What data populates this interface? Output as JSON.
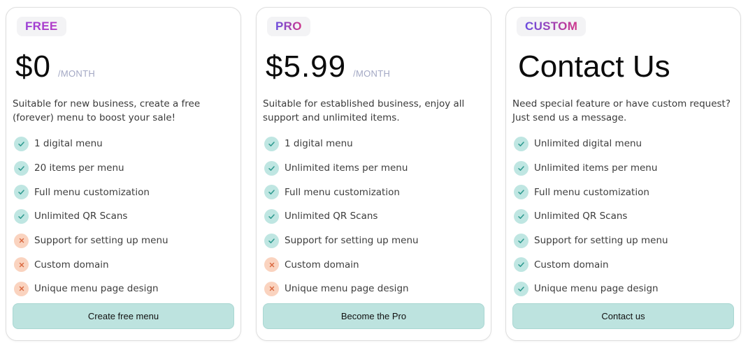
{
  "plans": [
    {
      "badge": "FREE",
      "price": "$0",
      "per": "/MONTH",
      "description": "Suitable for new business, create a free (forever) menu to boost your sale!",
      "features": [
        {
          "label": "1 digital menu",
          "icon": "check-icon",
          "included": true
        },
        {
          "label": "20 items per menu",
          "icon": "check-icon",
          "included": true
        },
        {
          "label": "Full menu customization",
          "icon": "check-icon",
          "included": true
        },
        {
          "label": "Unlimited QR Scans",
          "icon": "check-icon",
          "included": true
        },
        {
          "label": "Support for setting up menu",
          "icon": "cross-icon",
          "included": false
        },
        {
          "label": "Custom domain",
          "icon": "cross-icon",
          "included": false
        },
        {
          "label": "Unique menu page design",
          "icon": "cross-icon",
          "included": false
        }
      ],
      "cta": "Create free menu"
    },
    {
      "badge": "PRO",
      "price": "$5.99",
      "per": "/MONTH",
      "description": "Suitable for established business, enjoy all support and unlimited items.",
      "features": [
        {
          "label": "1 digital menu",
          "icon": "check-icon",
          "included": true
        },
        {
          "label": "Unlimited items per menu",
          "icon": "check-icon",
          "included": true
        },
        {
          "label": "Full menu customization",
          "icon": "check-icon",
          "included": true
        },
        {
          "label": "Unlimited QR Scans",
          "icon": "check-icon",
          "included": true
        },
        {
          "label": "Support for setting up menu",
          "icon": "check-icon",
          "included": true
        },
        {
          "label": "Custom domain",
          "icon": "cross-icon",
          "included": false
        },
        {
          "label": "Unique menu page design",
          "icon": "cross-icon",
          "included": false
        }
      ],
      "cta": "Become the Pro"
    },
    {
      "badge": "CUSTOM",
      "price": "Contact Us",
      "per": "",
      "description": "Need special feature or have custom request? Just send us a message.",
      "features": [
        {
          "label": "Unlimited digital menu",
          "icon": "check-icon",
          "included": true
        },
        {
          "label": "Unlimited items per menu",
          "icon": "check-icon",
          "included": true
        },
        {
          "label": "Full menu customization",
          "icon": "check-icon",
          "included": true
        },
        {
          "label": "Unlimited QR Scans",
          "icon": "check-icon",
          "included": true
        },
        {
          "label": "Support for setting up menu",
          "icon": "check-icon",
          "included": true
        },
        {
          "label": "Custom domain",
          "icon": "check-icon",
          "included": true
        },
        {
          "label": "Unique menu page design",
          "icon": "check-icon",
          "included": true
        }
      ],
      "cta": "Contact us"
    }
  ],
  "colors": {
    "check_bg": "#bfe6e2",
    "check_fg": "#2e9a8f",
    "cross_bg": "#fad3bf",
    "cross_fg": "#d9683f",
    "cta_bg": "#bde3df"
  }
}
